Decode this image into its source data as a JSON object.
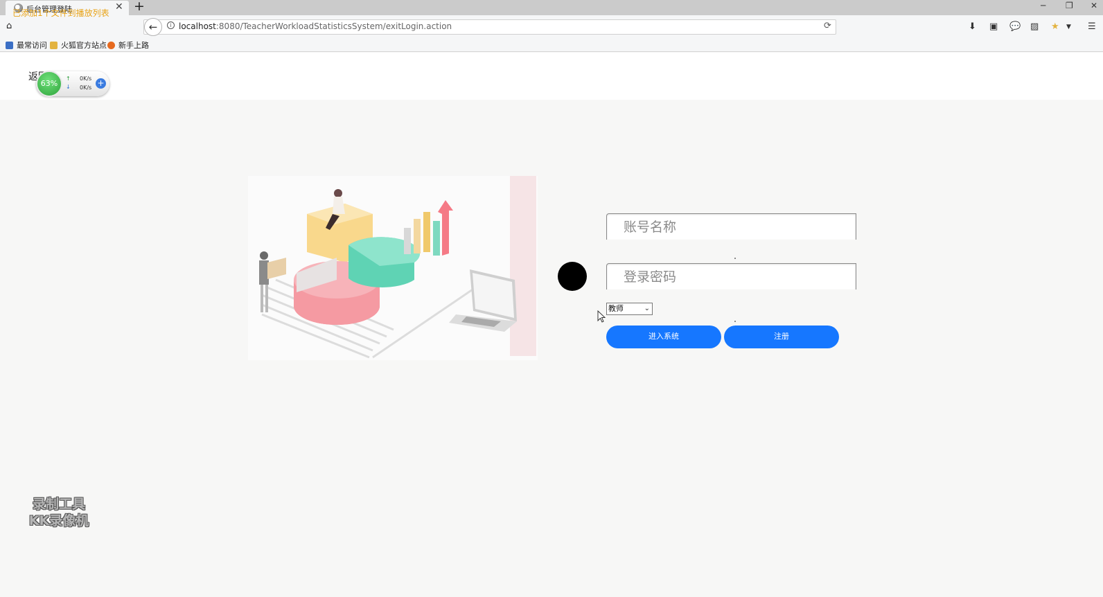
{
  "browser": {
    "tab_title": "后台管理登陆",
    "tab_notice": "已添加1个文件到播放列表",
    "url_host": "localhost",
    "url_rest": ":8080/TeacherWorkloadStatisticsSystem/exitLogin.action",
    "bookmarks": [
      {
        "label": "最常访问",
        "color": "#3b6fc5"
      },
      {
        "label": "火狐官方站点",
        "color": "#e3b341"
      },
      {
        "label": "新手上路",
        "color": "#e66a1f"
      }
    ]
  },
  "page": {
    "back_link": "返回",
    "login": {
      "username_placeholder": "账号名称",
      "password_placeholder": "登录密码",
      "role_selected": "教师",
      "submit_label": "进入系统",
      "register_label": "注册"
    }
  },
  "overlays": {
    "net_percent": "63%",
    "net_up": "0K/s",
    "net_down": "0K/s",
    "watermark_line1": "录制工具",
    "watermark_line2": "KK录像机"
  },
  "colors": {
    "primary_button": "#1677ff",
    "page_background": "#f7f7f6"
  }
}
